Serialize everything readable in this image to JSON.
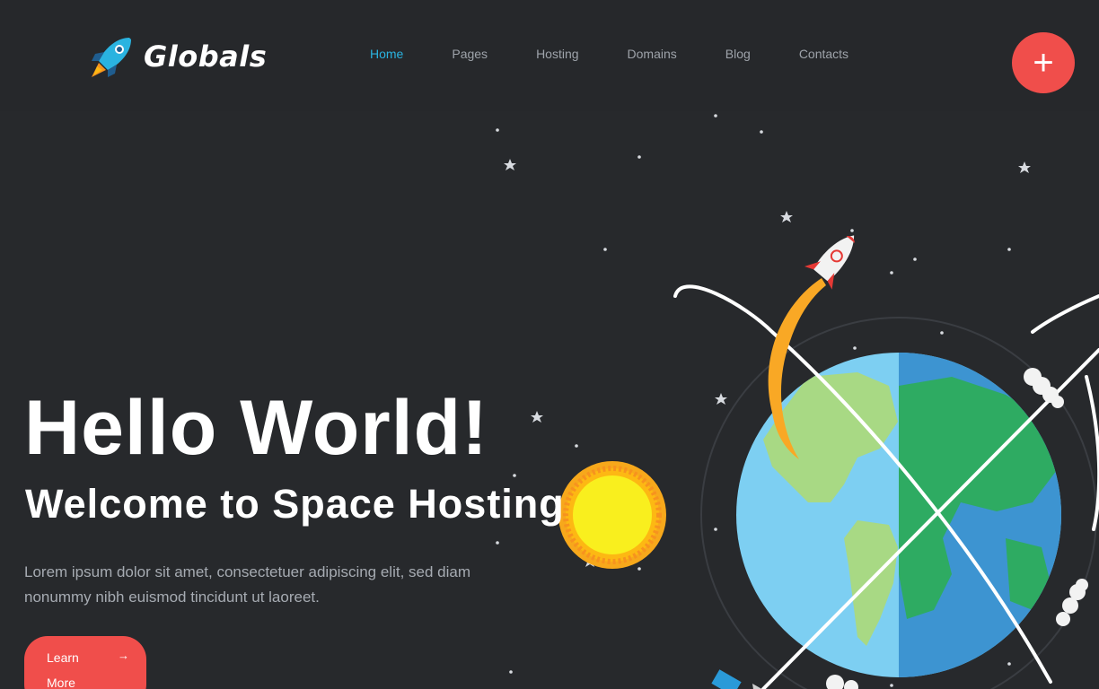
{
  "brand": {
    "name": "Globals",
    "logo_icon": "rocket-icon"
  },
  "nav": {
    "items": [
      {
        "label": "Home",
        "active": true
      },
      {
        "label": "Pages",
        "active": false
      },
      {
        "label": "Hosting",
        "active": false
      },
      {
        "label": "Domains",
        "active": false
      },
      {
        "label": "Blog",
        "active": false
      },
      {
        "label": "Contacts",
        "active": false
      }
    ]
  },
  "action_button": {
    "icon": "plus-icon",
    "label": "+"
  },
  "hero": {
    "title": "Hello World!",
    "subtitle": "Welcome to Space Hosting",
    "description": "Lorem ipsum dolor sit amet, consectetuer adipiscing elit, sed diam nonummy nibh euismod tincidunt ut laoreet.",
    "cta_label": "Learn More",
    "cta_icon": "arrow-right-icon"
  },
  "colors": {
    "background": "#27292c",
    "accent": "#f04e4b",
    "nav_active": "#2ab3e0",
    "nav_text": "#9ea3aa"
  }
}
